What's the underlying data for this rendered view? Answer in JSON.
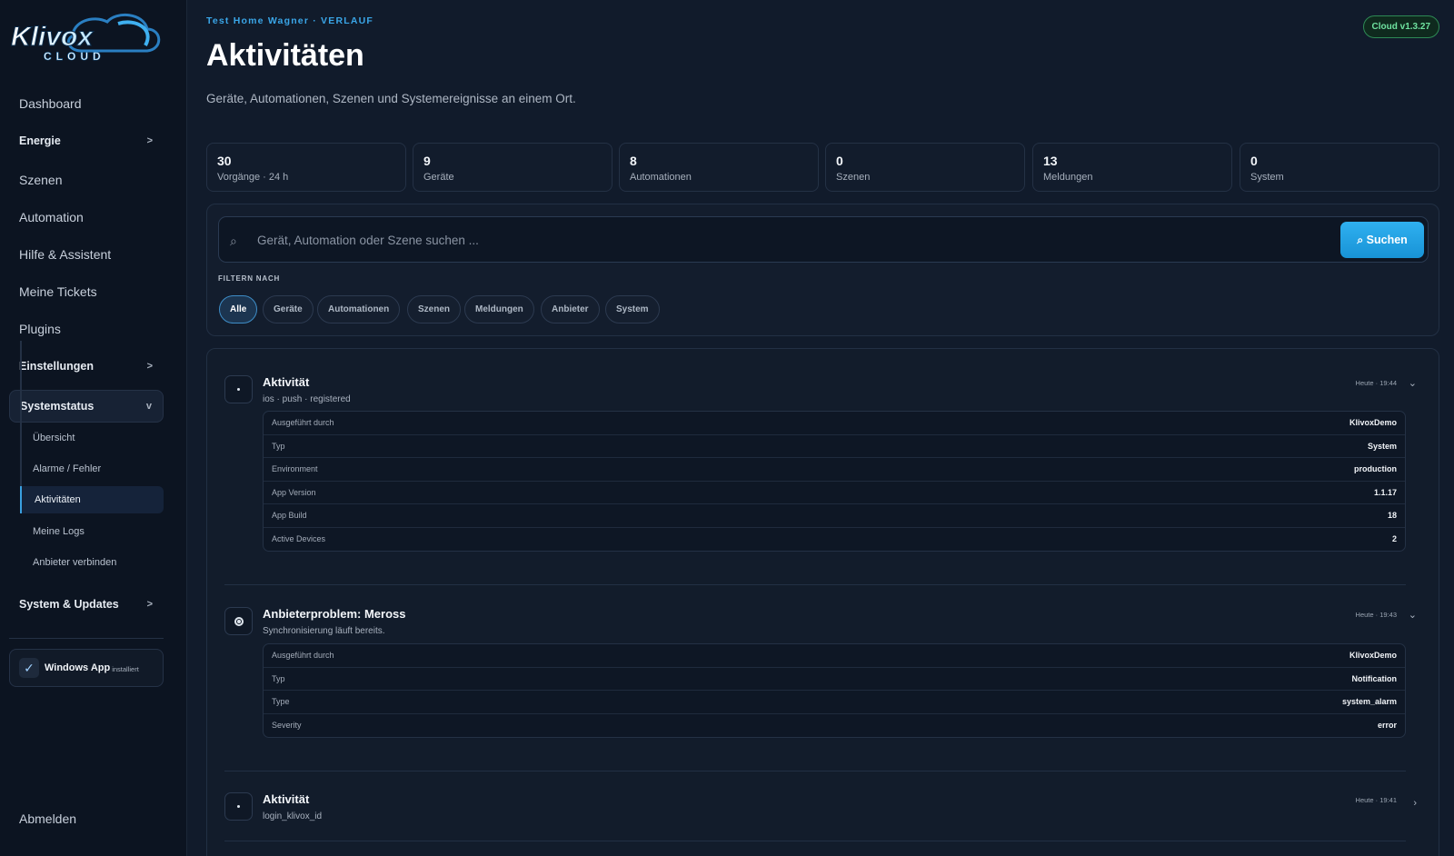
{
  "sidebar": {
    "logo": {
      "brand": "Klivox",
      "tagline": "CLOUD"
    },
    "items": [
      {
        "label": "Dashboard"
      },
      {
        "label": "Energie",
        "chevron": ">"
      },
      {
        "label": "Szenen"
      },
      {
        "label": "Automation"
      },
      {
        "label": "Hilfe & Assistent"
      },
      {
        "label": "Meine Tickets"
      },
      {
        "label": "Plugins"
      },
      {
        "label": "Einstellungen",
        "chevron": ">"
      },
      {
        "label": "Systemstatus",
        "chevron": "v"
      },
      {
        "label": "System & Updates",
        "chevron": ">"
      }
    ],
    "subitems": [
      {
        "label": "Übersicht"
      },
      {
        "label": "Alarme / Fehler"
      },
      {
        "label": "Aktivitäten"
      },
      {
        "label": "Meine Logs"
      },
      {
        "label": "Anbieter verbinden"
      }
    ],
    "windows_app": {
      "check": "✓",
      "title": "Windows App",
      "status": "installiert"
    },
    "logout": "Abmelden"
  },
  "header": {
    "eyebrow": "Test Home Wagner · VERLAUF",
    "version": "Cloud v1.3.27",
    "title": "Aktivitäten",
    "subtitle": "Geräte, Automationen, Szenen und Systemereignisse an einem Ort."
  },
  "stats": [
    {
      "value": "30",
      "label": "Vorgänge · 24 h"
    },
    {
      "value": "9",
      "label": "Geräte"
    },
    {
      "value": "8",
      "label": "Automationen"
    },
    {
      "value": "0",
      "label": "Szenen"
    },
    {
      "value": "13",
      "label": "Meldungen"
    },
    {
      "value": "0",
      "label": "System"
    }
  ],
  "search": {
    "icon": "⌕",
    "placeholder": "Gerät, Automation oder Szene suchen ...",
    "value": "",
    "button": "⌕ Suchen"
  },
  "filters": {
    "label": "FILTERN NACH",
    "chips": [
      {
        "label": "Alle",
        "active": true
      },
      {
        "label": "Geräte"
      },
      {
        "label": "Automationen"
      },
      {
        "label": "Szenen"
      },
      {
        "label": "Meldungen"
      },
      {
        "label": "Anbieter"
      },
      {
        "label": "System"
      }
    ]
  },
  "activities": [
    {
      "icon": "dot-icon",
      "title": "Aktivität",
      "subtitle": "ios · push · registered",
      "time": "Heute · 19:44",
      "toggle": "⌄",
      "details": [
        {
          "k": "Ausgeführt durch",
          "v": "KlivoxDemo"
        },
        {
          "k": "Typ",
          "v": "System"
        },
        {
          "k": "Environment",
          "v": "production"
        },
        {
          "k": "App Version",
          "v": "1.1.17"
        },
        {
          "k": "App Build",
          "v": "18"
        },
        {
          "k": "Active Devices",
          "v": "2"
        }
      ]
    },
    {
      "icon": "alert-ring-icon",
      "title": "Anbieterproblem: Meross",
      "subtitle": "Synchronisierung läuft bereits.",
      "time": "Heute · 19:43",
      "toggle": "⌄",
      "details": [
        {
          "k": "Ausgeführt durch",
          "v": "KlivoxDemo"
        },
        {
          "k": "Typ",
          "v": "Notification"
        },
        {
          "k": "Type",
          "v": "system_alarm"
        },
        {
          "k": "Severity",
          "v": "error"
        }
      ]
    },
    {
      "icon": "dot-icon",
      "title": "Aktivität",
      "subtitle": "login_klivox_id",
      "time": "Heute · 19:41",
      "toggle": "›"
    }
  ]
}
